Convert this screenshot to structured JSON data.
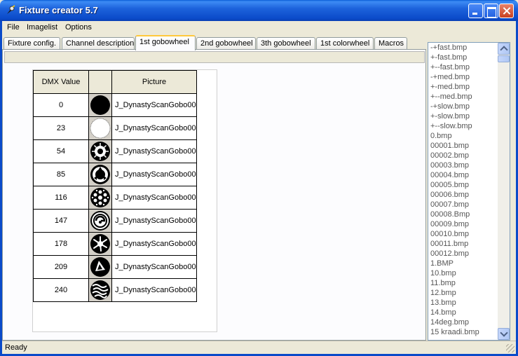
{
  "window": {
    "title": "Fixture creator 5.7"
  },
  "menu": [
    "File",
    "Imagelist",
    "Options"
  ],
  "tabs": [
    {
      "label": "Fixture config.",
      "active": false
    },
    {
      "label": "Channel description",
      "active": false
    },
    {
      "label": "1st gobowheel",
      "active": true
    },
    {
      "label": "2nd gobowheel",
      "active": false
    },
    {
      "label": "3th gobowheel",
      "active": false
    },
    {
      "label": "1st colorwheel",
      "active": false
    },
    {
      "label": "Macros",
      "active": false
    }
  ],
  "grid": {
    "headers": {
      "dmx": "DMX Value",
      "image": "",
      "picture": "Picture"
    },
    "rows": [
      {
        "dmx": "0",
        "icon": "gobo-solid-black-icon",
        "picture": "J_DynastyScanGobo00"
      },
      {
        "dmx": "23",
        "icon": "gobo-open-white-icon",
        "picture": "J_DynastyScanGobo00"
      },
      {
        "dmx": "54",
        "icon": "gobo-sun-burst-icon",
        "picture": "J_DynastyScanGobo00"
      },
      {
        "dmx": "85",
        "icon": "gobo-ring-triangle-icon",
        "picture": "J_DynastyScanGobo00"
      },
      {
        "dmx": "116",
        "icon": "gobo-dots-icon",
        "picture": "J_DynastyScanGobo00"
      },
      {
        "dmx": "147",
        "icon": "gobo-swirl-ring-icon",
        "picture": "J_DynastyScanGobo00"
      },
      {
        "dmx": "178",
        "icon": "gobo-splash-icon",
        "picture": "J_DynastyScanGobo00"
      },
      {
        "dmx": "209",
        "icon": "gobo-triangle-icon",
        "picture": "J_DynastyScanGobo00"
      },
      {
        "dmx": "240",
        "icon": "gobo-waves-icon",
        "picture": "J_DynastyScanGobo00"
      }
    ]
  },
  "image_list": [
    "-+fast.bmp",
    "+-fast.bmp",
    "+--fast.bmp",
    "-+med.bmp",
    "+-med.bmp",
    "+--med.bmp",
    "-+slow.bmp",
    "+-slow.bmp",
    "+--slow.bmp",
    "0.bmp",
    "00001.bmp",
    "00002.bmp",
    "00003.bmp",
    "00004.bmp",
    "00005.bmp",
    "00006.bmp",
    "00007.bmp",
    "00008.Bmp",
    "00009.bmp",
    "00010.bmp",
    "00011.bmp",
    "00012.bmp",
    "1.BMP",
    "10.bmp",
    "11.bmp",
    "12.bmp",
    "13.bmp",
    "14.bmp",
    "14deg.bmp",
    "15 kraadi.bmp"
  ],
  "status": {
    "text": "Ready"
  },
  "colors": {
    "titlebar": "#0b4ac9",
    "tab_highlight": "#ffc83c",
    "image_column": "#d4d0c8"
  }
}
